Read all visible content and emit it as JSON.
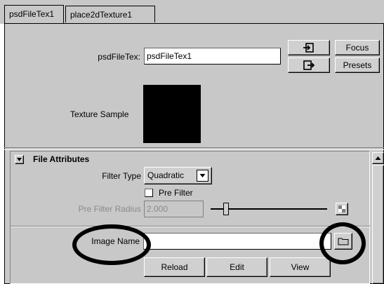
{
  "tabs": [
    {
      "label": "psdFileTex1"
    },
    {
      "label": "place2dTexture1"
    }
  ],
  "node": {
    "label": "psdFileTex:",
    "value": "psdFileTex1",
    "focus_label": "Focus",
    "presets_label": "Presets"
  },
  "texture_sample": {
    "label": "Texture Sample",
    "swatch_color": "#000000"
  },
  "file_attributes": {
    "title": "File Attributes",
    "filter_type_label": "Filter Type",
    "filter_type_value": "Quadratic",
    "pre_filter_label": "Pre Filter",
    "pre_filter_radius_label": "Pre Filter Radius",
    "pre_filter_radius_value": "2.000",
    "image_name_label": "Image Name",
    "image_name_value": "",
    "reload_label": "Reload",
    "edit_label": "Edit",
    "view_label": "View"
  },
  "colors": {
    "panel_bg": "#c8c8c8",
    "annotation": "#000000"
  }
}
